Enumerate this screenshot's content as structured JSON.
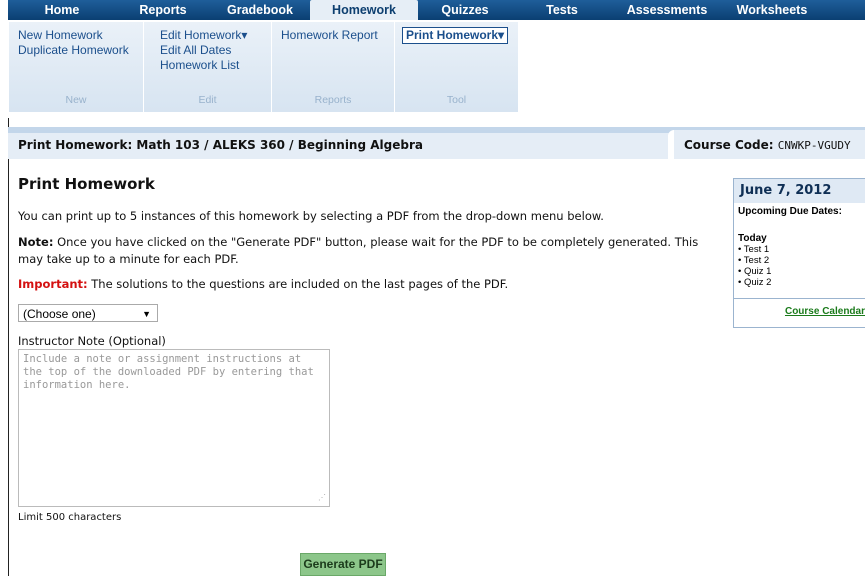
{
  "nav": {
    "tabs": [
      {
        "label": "Home"
      },
      {
        "label": "Reports"
      },
      {
        "label": "Gradebook"
      },
      {
        "label": "Homework"
      },
      {
        "label": "Quizzes"
      },
      {
        "label": "Tests"
      },
      {
        "label": "Assessments"
      },
      {
        "label": "Worksheets"
      }
    ],
    "active": "Homework"
  },
  "ribbon": {
    "new": {
      "items": [
        "New Homework",
        "Duplicate Homework"
      ],
      "label": "New"
    },
    "edit": {
      "items": [
        "Edit Homework▾",
        "Edit All Dates",
        "Homework List"
      ],
      "label": "Edit"
    },
    "reports": {
      "items": [
        "Homework Report"
      ],
      "label": "Reports"
    },
    "tool": {
      "items": [
        "Print Homework▾"
      ],
      "label": "Tool"
    }
  },
  "header": {
    "title": "Print Homework: Math 103 / ALEKS 360 / Beginning Algebra",
    "course_code_label": "Course Code:",
    "course_code": "CNWKP-VGUDY"
  },
  "main": {
    "heading": "Print Homework",
    "intro": "You can print up to 5 instances of this homework by selecting a PDF from the drop-down menu below.",
    "note_label": "Note:",
    "note_text": " Once you have clicked on the \"Generate PDF\" button, please wait for the PDF to be completely generated. This may take up to a minute for each PDF.",
    "important_label": "Important:",
    "important_text": " The solutions to the questions are included on the last pages of the PDF.",
    "select_value": "(Choose one)",
    "note_field_label": "Instructor Note (Optional)",
    "note_placeholder": "Include a note or assignment instructions at the top of the downloaded PDF by entering that information here.",
    "limit_text": "Limit 500 characters",
    "generate_button": "Generate PDF"
  },
  "sidebar": {
    "date": "June 7, 2012",
    "upcoming": "Upcoming Due Dates:",
    "today": "Today",
    "items": [
      "Test 1",
      "Test 2",
      "Quiz 1",
      "Quiz 2"
    ],
    "calendar_link": "Course Calendar"
  }
}
